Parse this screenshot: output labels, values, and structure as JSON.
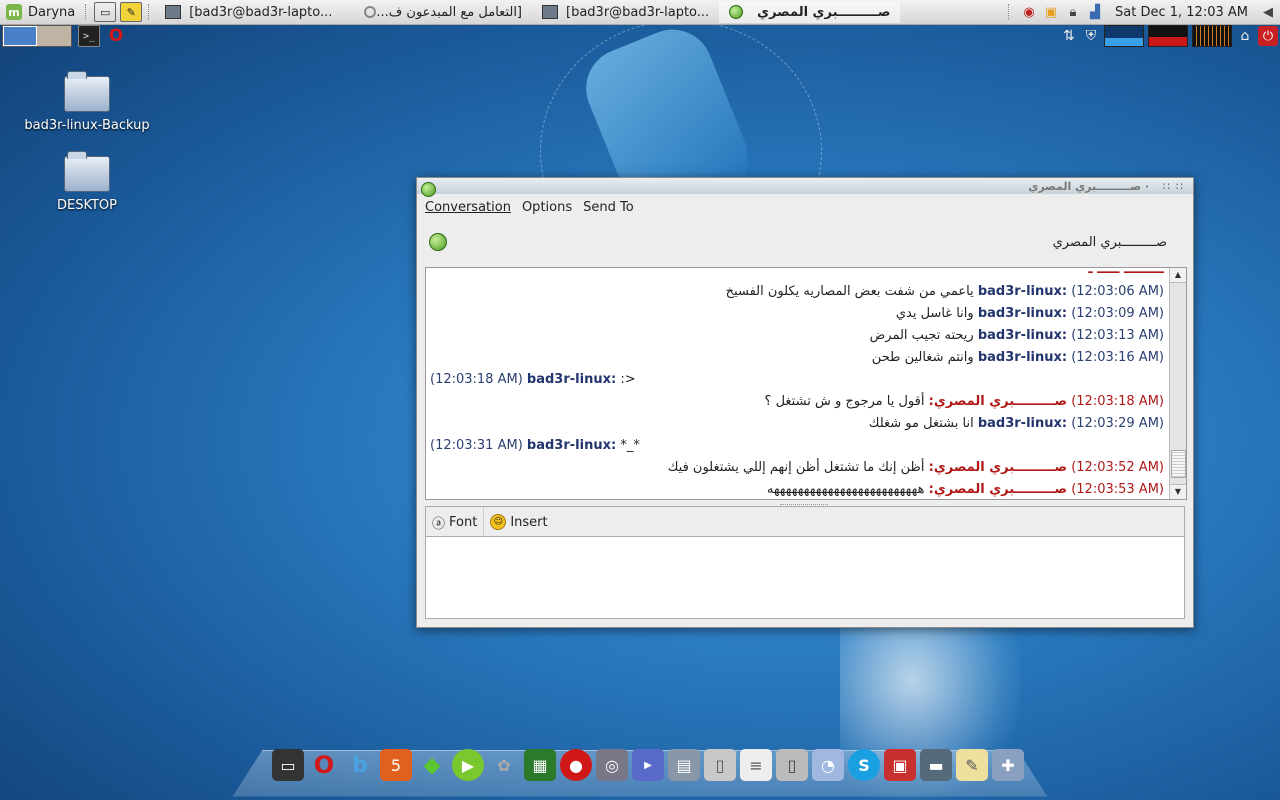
{
  "top_panel": {
    "menu_label": "Daryna",
    "tasks": [
      {
        "label": "[bad3r@bad3r-lapto...",
        "active": false
      },
      {
        "label": "[التعامل مع المبدعون ف...",
        "active": false
      },
      {
        "label": "[bad3r@bad3r-lapto...",
        "active": false
      },
      {
        "label": "صـــــــــبري المصري",
        "active": true
      }
    ],
    "clock": "Sat Dec  1, 12:03 AM"
  },
  "desktop": {
    "icons": [
      {
        "label": "bad3r-linux-Backup"
      },
      {
        "label": "DESKTOP"
      }
    ]
  },
  "chat_window": {
    "title": "· صـــــــــبري المصري",
    "menus": [
      {
        "label": "Conversation",
        "mnemonic": "C"
      },
      {
        "label": "Options",
        "mnemonic": "O"
      },
      {
        "label": "Send To",
        "mnemonic": "S"
      }
    ],
    "buddy_name": "صـــــــــبري المصري",
    "messages": [
      {
        "dir": "r",
        "type": "me",
        "time": "(12:03:06 AM)",
        "sender": "bad3r-linux:",
        "text": "ياعمي من شفت بعض المصاريه يكلون الفسيخ"
      },
      {
        "dir": "r",
        "type": "me",
        "time": "(12:03:09 AM)",
        "sender": "bad3r-linux:",
        "text": "وانا غاسل يدي"
      },
      {
        "dir": "r",
        "type": "me",
        "time": "(12:03:13 AM)",
        "sender": "bad3r-linux:",
        "text": "ريحته تجيب المرض"
      },
      {
        "dir": "r",
        "type": "me",
        "time": "(12:03:16 AM)",
        "sender": "bad3r-linux:",
        "text": "وانتم شغالين طحن"
      },
      {
        "dir": "l",
        "type": "me",
        "time": "(12:03:18 AM)",
        "sender": "bad3r-linux:",
        "text": ":>"
      },
      {
        "dir": "r",
        "type": "them",
        "time": "(12:03:18 AM)",
        "sender": "صـــــــــبري المصري:",
        "text": "أقول يا مرجوج و ش تشتغل ؟"
      },
      {
        "dir": "r",
        "type": "me",
        "time": "(12:03:29 AM)",
        "sender": "bad3r-linux:",
        "text": "انا بشتغل مو شغلك"
      },
      {
        "dir": "l",
        "type": "me",
        "time": "(12:03:31 AM)",
        "sender": "bad3r-linux:",
        "text": "*_*"
      },
      {
        "dir": "r",
        "type": "them",
        "time": "(12:03:52 AM)",
        "sender": "صـــــــــبري المصري:",
        "text": "أظن إنك ما تشتغل أظن إنهم إللي يشتغلون فيك"
      },
      {
        "dir": "r",
        "type": "them",
        "time": "(12:03:53 AM)",
        "sender": "صـــــــــبري المصري:",
        "text": "هههههههههههههههههههههههههه"
      }
    ],
    "format_bar": {
      "font_label": "Font",
      "insert_label": "Insert"
    },
    "input_value": ""
  },
  "colors": {
    "my_name": "#22356e",
    "their_name": "#b01818",
    "accent_green": "#4a9a1e"
  }
}
